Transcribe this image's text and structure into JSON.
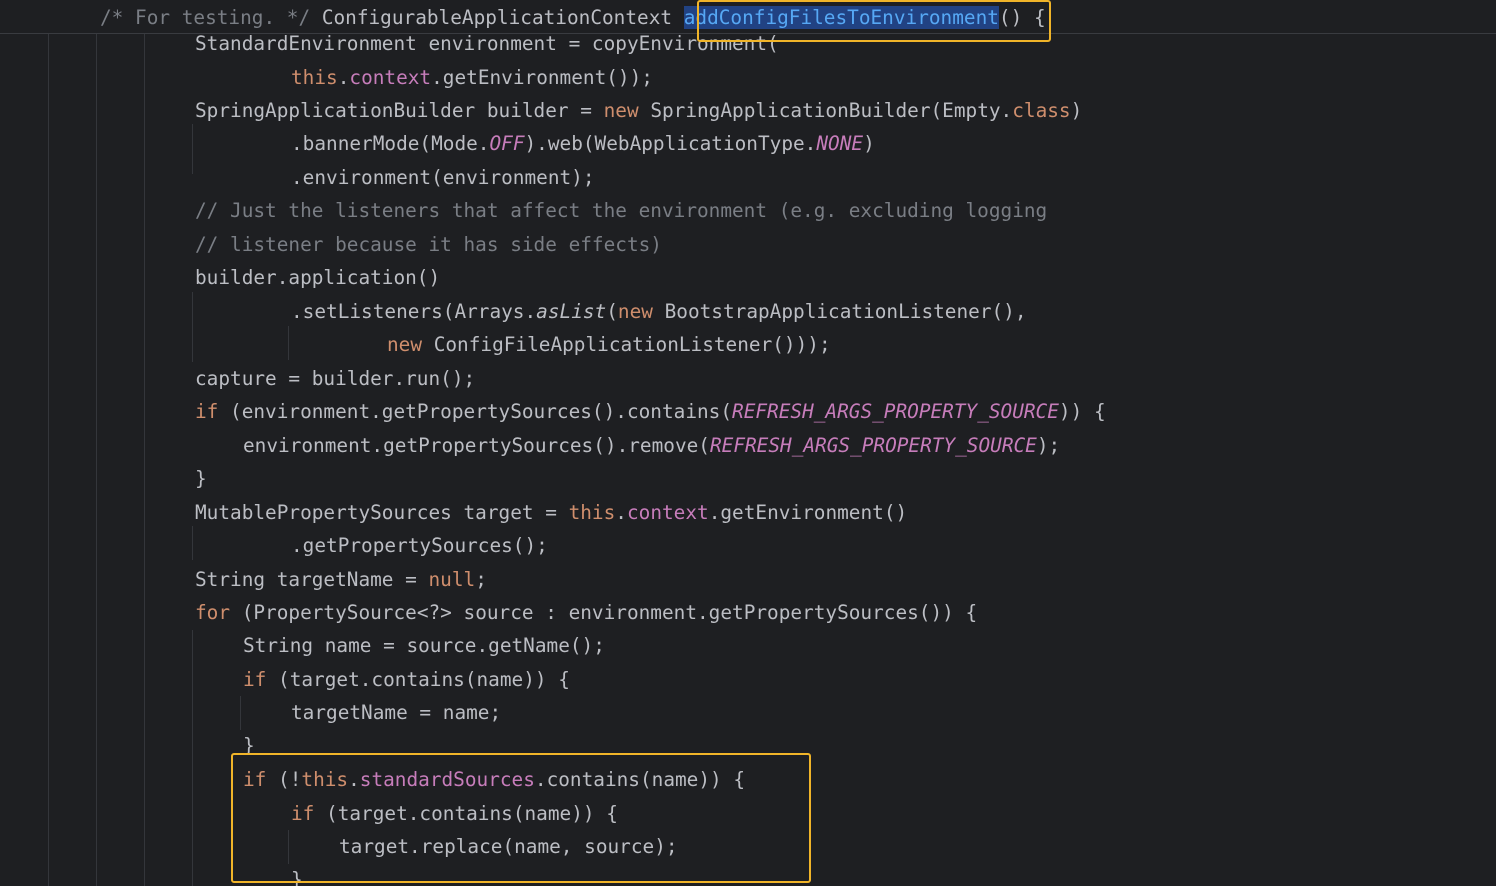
{
  "editor": {
    "highlight_color": "#f0b429",
    "colors": {
      "background": "#1e1f22",
      "text": "#bcbec4",
      "keyword": "#cf8e6d",
      "field": "#c77dbb",
      "comment": "#7a7e85",
      "declaration": "#56a8f5"
    },
    "lines": [
      [
        [
          "comment",
          "/* For testing. */"
        ],
        [
          "plain",
          " ConfigurableApplicationContext "
        ],
        [
          "method",
          "addConfigFilesToEnvironment"
        ],
        [
          "plain",
          "() {"
        ]
      ],
      [
        [
          "plain",
          "StandardEnvironment environment = copyEnvironment("
        ]
      ],
      [
        [
          "keyword",
          "this"
        ],
        [
          "plain",
          "."
        ],
        [
          "field",
          "context"
        ],
        [
          "plain",
          ".getEnvironment());"
        ]
      ],
      [
        [
          "plain",
          "SpringApplicationBuilder builder = "
        ],
        [
          "keyword",
          "new"
        ],
        [
          "plain",
          " SpringApplicationBuilder(Empty."
        ],
        [
          "keyword",
          "class"
        ],
        [
          "plain",
          ")"
        ]
      ],
      [
        [
          "plain",
          ".bannerMode(Mode."
        ],
        [
          "const",
          "OFF"
        ],
        [
          "plain",
          ").web(WebApplicationType."
        ],
        [
          "const",
          "NONE"
        ],
        [
          "plain",
          ")"
        ]
      ],
      [
        [
          "plain",
          ".environment(environment);"
        ]
      ],
      [
        [
          "comment",
          "// Just the listeners that affect the environment (e.g. excluding logging"
        ]
      ],
      [
        [
          "comment",
          "// listener because it has side effects)"
        ]
      ],
      [
        [
          "plain",
          "builder.application()"
        ]
      ],
      [
        [
          "plain",
          ".setListeners(Arrays."
        ],
        [
          "static",
          "asList"
        ],
        [
          "plain",
          "("
        ],
        [
          "keyword",
          "new"
        ],
        [
          "plain",
          " BootstrapApplicationListener(),"
        ]
      ],
      [
        [
          "keyword",
          "new"
        ],
        [
          "plain",
          " ConfigFileApplicationListener()));"
        ]
      ],
      [
        [
          "plain",
          "capture = builder.run();"
        ]
      ],
      [
        [
          "keyword",
          "if"
        ],
        [
          "plain",
          " (environment.getPropertySources().contains("
        ],
        [
          "const",
          "REFRESH_ARGS_PROPERTY_SOURCE"
        ],
        [
          "plain",
          ")) {"
        ]
      ],
      [
        [
          "plain",
          "environment.getPropertySources().remove("
        ],
        [
          "const",
          "REFRESH_ARGS_PROPERTY_SOURCE"
        ],
        [
          "plain",
          ");"
        ]
      ],
      [
        [
          "plain",
          "}"
        ]
      ],
      [
        [
          "plain",
          "MutablePropertySources target = "
        ],
        [
          "keyword",
          "this"
        ],
        [
          "plain",
          "."
        ],
        [
          "field",
          "context"
        ],
        [
          "plain",
          ".getEnvironment()"
        ]
      ],
      [
        [
          "plain",
          ".getPropertySources();"
        ]
      ],
      [
        [
          "plain",
          "String targetName = "
        ],
        [
          "keyword",
          "null"
        ],
        [
          "plain",
          ";"
        ]
      ],
      [
        [
          "keyword",
          "for"
        ],
        [
          "plain",
          " (PropertySource<?> source : environment.getPropertySources()) {"
        ]
      ],
      [
        [
          "plain",
          "String name = source.getName();"
        ]
      ],
      [
        [
          "keyword",
          "if"
        ],
        [
          "plain",
          " (target.contains(name)) {"
        ]
      ],
      [
        [
          "plain",
          "targetName = name;"
        ]
      ],
      [
        [
          "plain",
          "}"
        ]
      ],
      [
        [
          "keyword",
          "if"
        ],
        [
          "plain",
          " (!"
        ],
        [
          "keyword",
          "this"
        ],
        [
          "plain",
          "."
        ],
        [
          "field",
          "standardSources"
        ],
        [
          "plain",
          ".contains(name)) {"
        ]
      ],
      [
        [
          "keyword",
          "if"
        ],
        [
          "plain",
          " (target.contains(name)) {"
        ]
      ],
      [
        [
          "plain",
          "target.replace(name, source);"
        ]
      ],
      [
        [
          "plain",
          "}"
        ]
      ]
    ]
  }
}
